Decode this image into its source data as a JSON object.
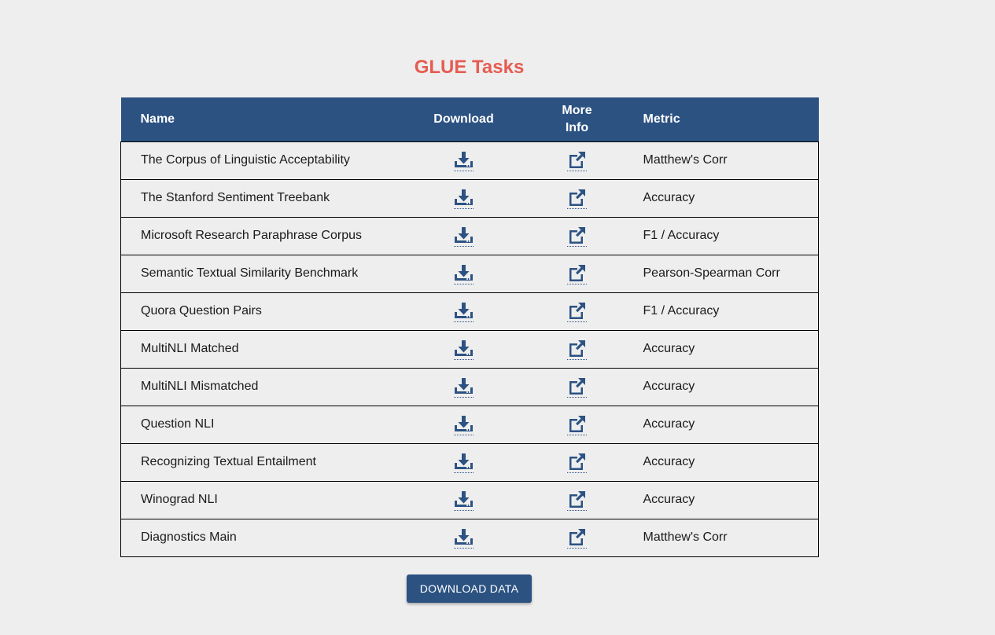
{
  "page": {
    "title": "GLUE Tasks",
    "download_button_label": "DOWNLOAD DATA"
  },
  "colors": {
    "title": "#e65c52",
    "accent": "#2c5282",
    "background": "#eeeeee"
  },
  "table": {
    "headers": {
      "name": "Name",
      "download": "Download",
      "more_info": "More Info",
      "metric": "Metric"
    },
    "rows": [
      {
        "name": "The Corpus of Linguistic Acceptability",
        "metric": "Matthew's Corr",
        "download_icon": "download-icon",
        "info_icon": "external-link-icon"
      },
      {
        "name": "The Stanford Sentiment Treebank",
        "metric": "Accuracy",
        "download_icon": "download-icon",
        "info_icon": "external-link-icon"
      },
      {
        "name": "Microsoft Research Paraphrase Corpus",
        "metric": "F1 / Accuracy",
        "download_icon": "download-icon",
        "info_icon": "external-link-icon"
      },
      {
        "name": "Semantic Textual Similarity Benchmark",
        "metric": "Pearson-Spearman Corr",
        "download_icon": "download-icon",
        "info_icon": "external-link-icon"
      },
      {
        "name": "Quora Question Pairs",
        "metric": "F1 / Accuracy",
        "download_icon": "download-icon",
        "info_icon": "external-link-icon"
      },
      {
        "name": "MultiNLI Matched",
        "metric": "Accuracy",
        "download_icon": "download-icon",
        "info_icon": "external-link-icon"
      },
      {
        "name": "MultiNLI Mismatched",
        "metric": "Accuracy",
        "download_icon": "download-icon",
        "info_icon": "external-link-icon"
      },
      {
        "name": "Question NLI",
        "metric": "Accuracy",
        "download_icon": "download-icon",
        "info_icon": "external-link-icon"
      },
      {
        "name": "Recognizing Textual Entailment",
        "metric": "Accuracy",
        "download_icon": "download-icon",
        "info_icon": "external-link-icon"
      },
      {
        "name": "Winograd NLI",
        "metric": "Accuracy",
        "download_icon": "download-icon",
        "info_icon": "external-link-icon"
      },
      {
        "name": "Diagnostics Main",
        "metric": "Matthew's Corr",
        "download_icon": "download-icon",
        "info_icon": "external-link-icon"
      }
    ]
  }
}
